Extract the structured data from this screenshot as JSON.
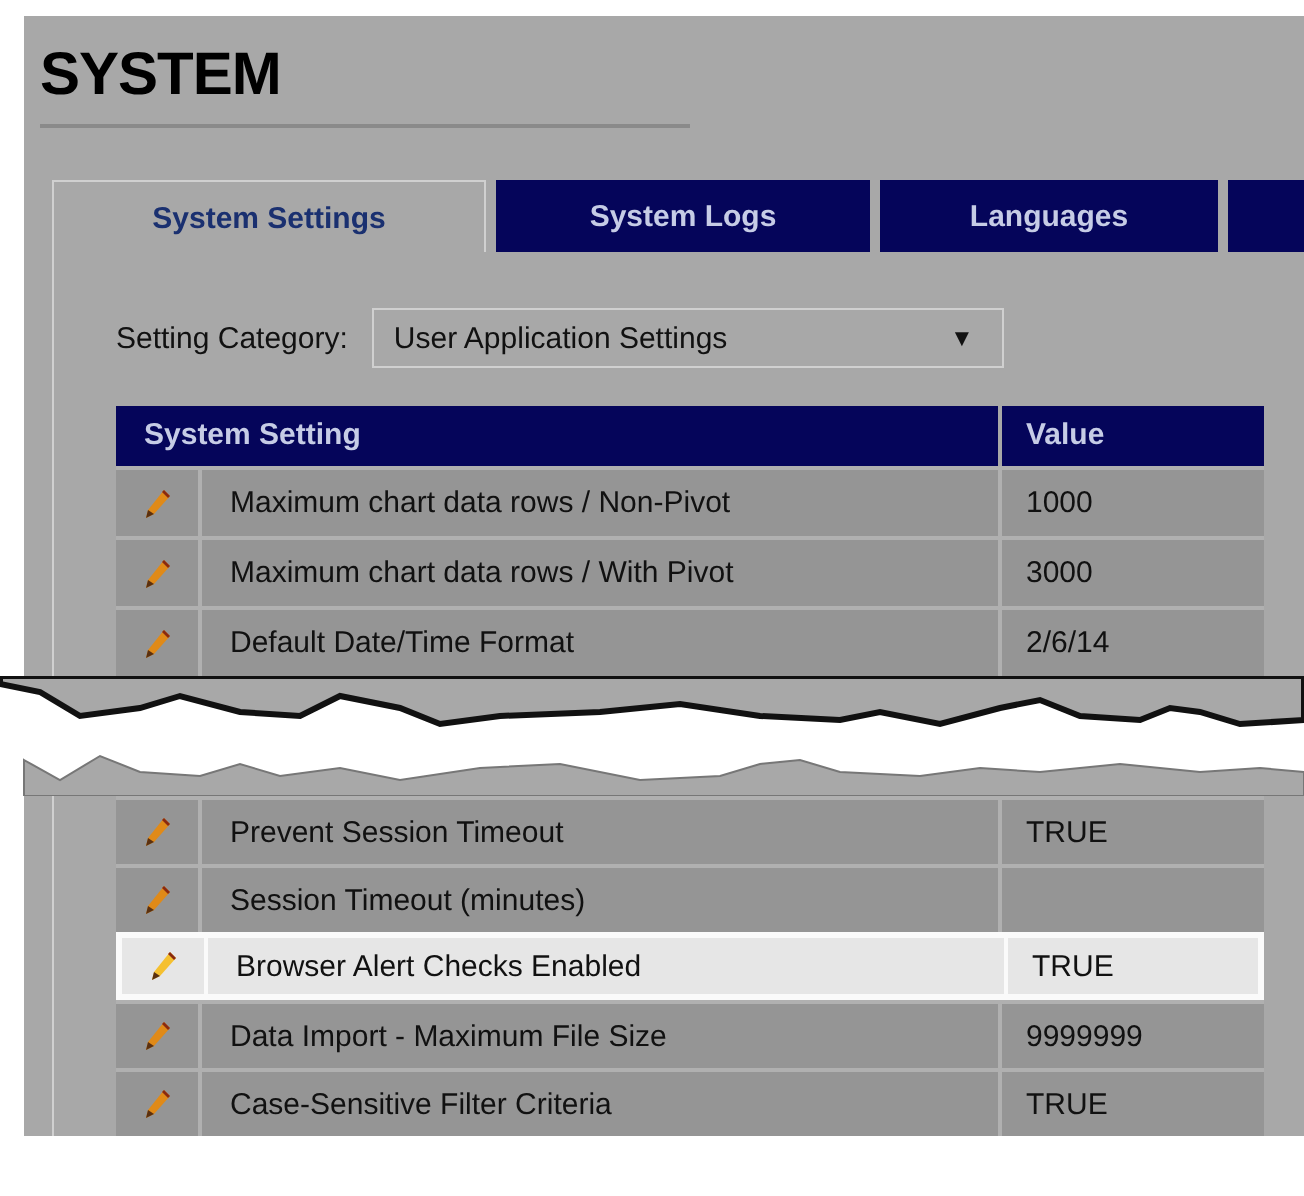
{
  "title": "SYSTEM",
  "tabs": [
    {
      "label": "System Settings",
      "selected": true
    },
    {
      "label": "System Logs",
      "selected": false
    },
    {
      "label": "Languages",
      "selected": false
    },
    {
      "selected": false
    }
  ],
  "category": {
    "label": "Setting Category:",
    "value": "User Application Settings",
    "arrow": "▼"
  },
  "table": {
    "columns": [
      "System Setting",
      "Value"
    ],
    "rows_top": [
      {
        "setting": "Maximum chart data rows / Non-Pivot",
        "value": "1000",
        "selected": false
      },
      {
        "setting": "Maximum chart data rows / With Pivot",
        "value": "3000",
        "selected": false
      },
      {
        "setting": "Default Date/Time Format",
        "value": "2/6/14",
        "selected": false
      }
    ],
    "rows_bottom": [
      {
        "setting": "Prevent Session Timeout",
        "value": "TRUE",
        "selected": false
      },
      {
        "setting": "Session Timeout (minutes)",
        "selected": false
      },
      {
        "setting": "Browser Alert Checks Enabled",
        "value": "TRUE",
        "selected": true
      },
      {
        "setting": "Data Import - Maximum File Size",
        "value": "9999999",
        "selected": false
      },
      {
        "setting": "Case-Sensitive Filter Criteria",
        "value": "TRUE",
        "selected": false
      }
    ]
  }
}
